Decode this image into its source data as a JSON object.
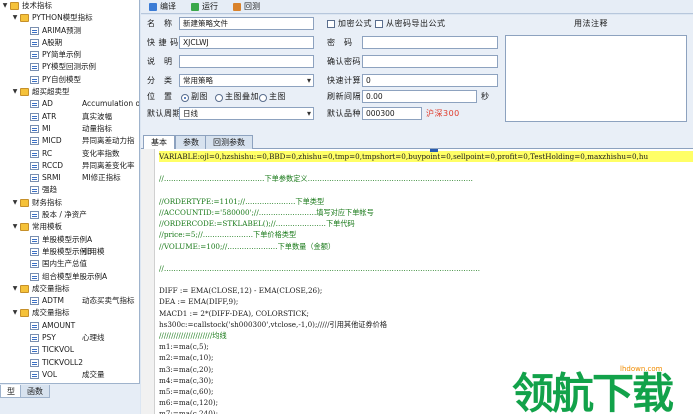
{
  "tree": {
    "rows": [
      {
        "label": "技术指标",
        "desc": "",
        "kind": "folder",
        "level": 0,
        "expanded": true
      },
      {
        "label": "PYTHON模型指标",
        "desc": "",
        "kind": "folder",
        "level": 1,
        "expanded": true
      },
      {
        "label": "ARIMA预测",
        "desc": "",
        "kind": "file",
        "level": 2
      },
      {
        "label": "A股期",
        "desc": "",
        "kind": "file",
        "level": 2
      },
      {
        "label": "PY简单示例",
        "desc": "",
        "kind": "file",
        "level": 2
      },
      {
        "label": "PY模型回测示例",
        "desc": "",
        "kind": "file",
        "level": 2
      },
      {
        "label": "PY自创模型",
        "desc": "",
        "kind": "file",
        "level": 2
      },
      {
        "label": "超买超卖型",
        "desc": "",
        "kind": "folder",
        "level": 1,
        "expanded": true
      },
      {
        "label": "AD",
        "desc": "Accumulation or",
        "kind": "file",
        "level": 2
      },
      {
        "label": "ATR",
        "desc": "真实波幅",
        "kind": "file",
        "level": 2
      },
      {
        "label": "MI",
        "desc": "动量指标",
        "kind": "file",
        "level": 2
      },
      {
        "label": "MICD",
        "desc": "异同离差动力指",
        "kind": "file",
        "level": 2
      },
      {
        "label": "RC",
        "desc": "变化率指数",
        "kind": "file",
        "level": 2
      },
      {
        "label": "RCCD",
        "desc": "异同离差变化率",
        "kind": "file",
        "level": 2
      },
      {
        "label": "SRMI",
        "desc": "MI修正指标",
        "kind": "file",
        "level": 2
      },
      {
        "label": "强趋",
        "desc": "",
        "kind": "file",
        "level": 2
      },
      {
        "label": "财务指标",
        "desc": "",
        "kind": "folder",
        "level": 1,
        "expanded": true
      },
      {
        "label": "股本 / 净资产",
        "desc": "",
        "kind": "file",
        "level": 2
      },
      {
        "label": "常用模板",
        "desc": "",
        "kind": "folder",
        "level": 1,
        "expanded": true
      },
      {
        "label": "单股模型示例A",
        "desc": "",
        "kind": "file",
        "level": 2
      },
      {
        "label": "单股模型示例B",
        "desc": "引用模",
        "kind": "file",
        "level": 2
      },
      {
        "label": "国内生产总值",
        "desc": "",
        "kind": "file",
        "level": 2
      },
      {
        "label": "组合模型单股示例A",
        "desc": "",
        "kind": "file",
        "level": 2
      },
      {
        "label": "成交量指标",
        "desc": "",
        "kind": "folder",
        "level": 1,
        "expanded": true
      },
      {
        "label": "ADTM",
        "desc": "动态买卖气指标",
        "kind": "file",
        "level": 2
      },
      {
        "label": "成交量指标",
        "desc": "",
        "kind": "folder",
        "level": 1,
        "expanded": true
      },
      {
        "label": "AMOUNT",
        "desc": "",
        "kind": "file",
        "level": 2
      },
      {
        "label": "PSY",
        "desc": "心理线",
        "kind": "file",
        "level": 2
      },
      {
        "label": "TICKVOL",
        "desc": "",
        "kind": "file",
        "level": 2
      },
      {
        "label": "TICKVOLL2",
        "desc": "",
        "kind": "file",
        "level": 2
      },
      {
        "label": "VOL",
        "desc": "成交量",
        "kind": "file",
        "level": 2
      }
    ]
  },
  "left_tabs": [
    "型",
    "函数"
  ],
  "toolbar": {
    "buttons": [
      {
        "label": "编译",
        "icon": "compile-icon",
        "color": "#3a7bd5"
      },
      {
        "label": "运行",
        "icon": "run-icon",
        "color": "#3aa84a"
      },
      {
        "label": "回测",
        "icon": "backtest-icon",
        "color": "#d9822b"
      }
    ]
  },
  "form": {
    "name_label": "名　称",
    "name_value": "新建策略文件",
    "password_label": "快 捷 码",
    "password_value": "XJCLWJ",
    "desc_label": "说　明",
    "desc_value": "",
    "category_label": "分　类",
    "category_value": "常用策略",
    "position_label": "位　置",
    "position_options": [
      "副图",
      "主图叠加",
      "主图"
    ],
    "period_label": "默认周期",
    "period_value": "日线",
    "encrypt_label": "加密公式",
    "export_label": "从密码导出公式",
    "pwd_label": "密　码",
    "confirm_label": "确认密码",
    "fast_calc_label": "快速计算",
    "fast_calc_value": "0",
    "refresh_label": "刷新间隔",
    "refresh_value": "0.00",
    "refresh_unit": "秒",
    "default_symbol_label": "默认品种",
    "default_symbol_value": "000300",
    "default_symbol_name": "沪深300",
    "notes_label": "用法注释"
  },
  "editor_tabs": [
    "基本",
    "参数",
    "回测参数"
  ],
  "code_lines": [
    {
      "text": "VARIABLE:ojl=0,hzshishu:=0,BBD=0,zhishu=0,tmp=0,tmpshort=0,buypoint=0,sellpoint=0,profit=0,TestHolding=0,maxzhishu=0,hu",
      "kind": "highlight"
    },
    {
      "text": "",
      "kind": "code"
    },
    {
      "text": "//……………………………………下单参数定义……………………………………………………………",
      "kind": "comment"
    },
    {
      "text": "",
      "kind": "code"
    },
    {
      "text": "//ORDERTYPE:=1101;//…………………下单类型",
      "kind": "comment"
    },
    {
      "text": "//ACCOUNTID:='580000';//……………………填写对应下单帐号",
      "kind": "comment"
    },
    {
      "text": "//ORDERCODE:=STKLABEL();//…………………下单代码",
      "kind": "comment"
    },
    {
      "text": "//price:=5;//…………………下单价格类型",
      "kind": "comment"
    },
    {
      "text": "//VOLUME:=100;//…………………下单数量（金额）",
      "kind": "comment"
    },
    {
      "text": "",
      "kind": "code"
    },
    {
      "text": "//……………………………………………………………………………………………………………………",
      "kind": "comment"
    },
    {
      "text": "",
      "kind": "code"
    },
    {
      "text": "DIFF := EMA(CLOSE,12) - EMA(CLOSE,26);",
      "kind": "code"
    },
    {
      "text": "DEA  := EMA(DIFF,9);",
      "kind": "code"
    },
    {
      "text": "MACD1 := 2*(DIFF-DEA), COLORSTICK;",
      "kind": "code"
    },
    {
      "text": "hs300c:=callstock('sh000300',vtclose,-1,0);/////引用其他证券价格",
      "kind": "code"
    },
    {
      "text": "//////////////////////均线",
      "kind": "comment"
    },
    {
      "text": "m1:=ma(c,5);",
      "kind": "code"
    },
    {
      "text": "m2:=ma(c,10);",
      "kind": "code"
    },
    {
      "text": "m3:=ma(c,20);",
      "kind": "code"
    },
    {
      "text": "m4:=ma(c,30);",
      "kind": "code"
    },
    {
      "text": "m5:=ma(c,60);",
      "kind": "code"
    },
    {
      "text": "m6:=ma(c,120);",
      "kind": "code"
    },
    {
      "text": "m7:=ma(c,240);",
      "kind": "code"
    }
  ],
  "watermark": {
    "logo": "领航下载",
    "url": "lhdown.com"
  },
  "colors": {
    "accent": "#2a5db0",
    "highlight_line": "#ffff66",
    "comment": "#1a7a1a",
    "symbol_name": "#e03a2a",
    "watermark_green": "#12a24a"
  }
}
